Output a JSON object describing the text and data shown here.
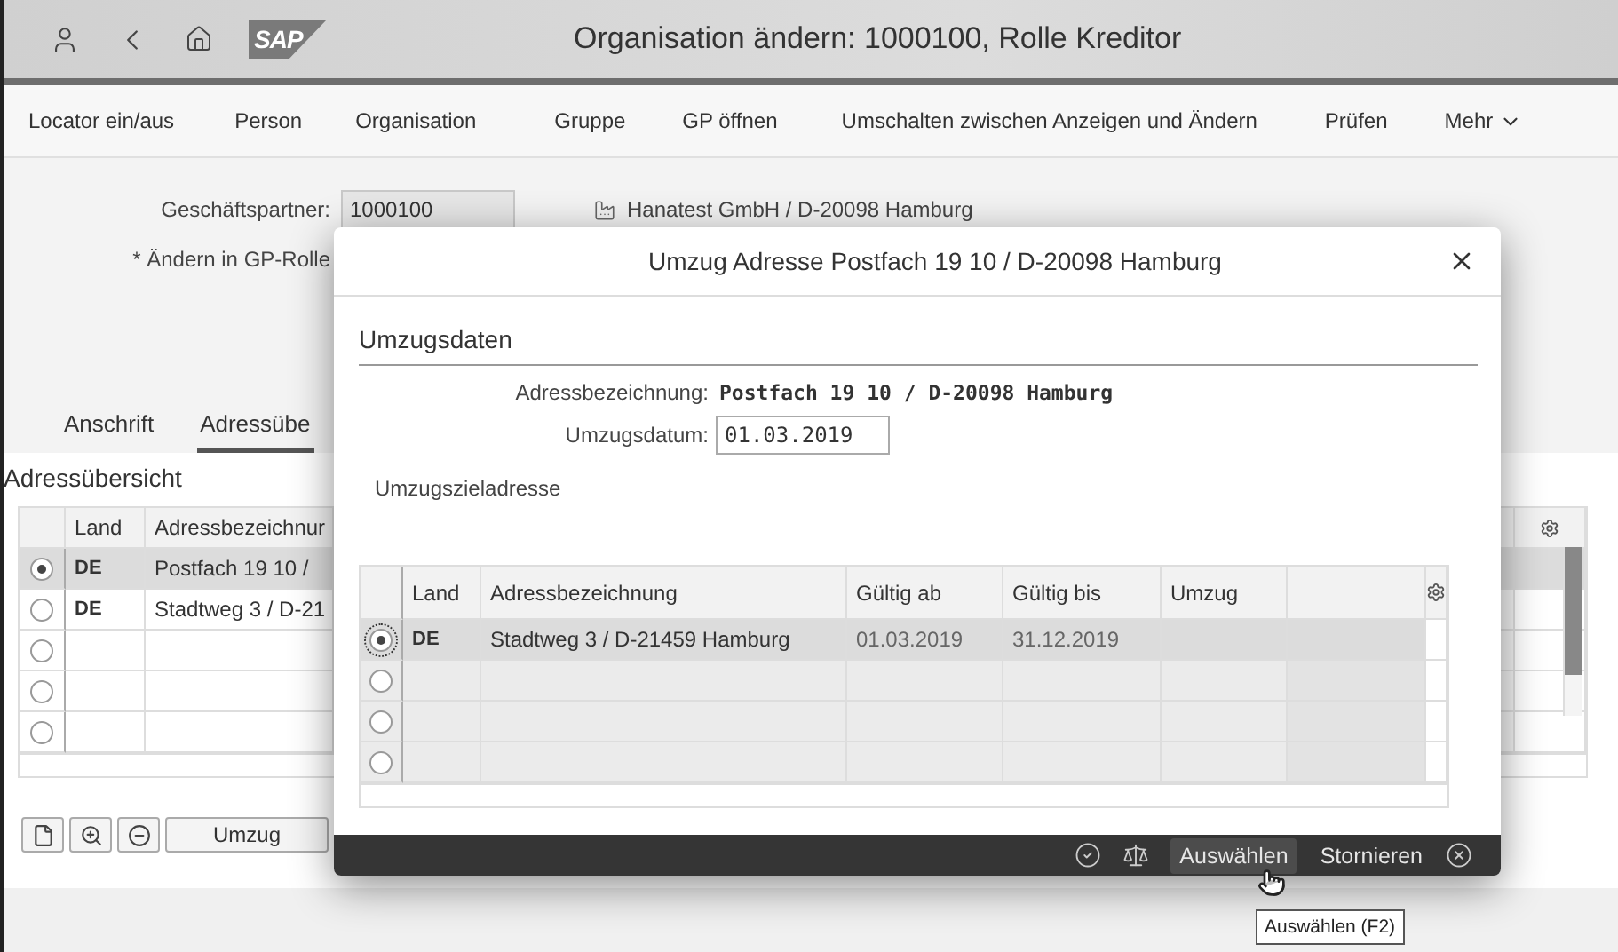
{
  "shell": {
    "logo": "SAP",
    "title": "Organisation ändern: 1000100, Rolle Kreditor"
  },
  "toolbar": [
    {
      "label": "Locator ein/aus",
      "kind": "action"
    },
    {
      "label": "Person",
      "kind": "action"
    },
    {
      "label": "Organisation",
      "kind": "action"
    },
    {
      "label": "Gruppe",
      "kind": "action"
    },
    {
      "label": "GP öffnen",
      "kind": "action"
    },
    {
      "label": "Umschalten zwischen Anzeigen und Ändern",
      "kind": "action"
    },
    {
      "label": "Prüfen",
      "kind": "action"
    },
    {
      "label": "Mehr",
      "kind": "menu"
    }
  ],
  "form": {
    "partner_label": "Geschäftspartner:",
    "partner_value": "1000100",
    "partner_name": "Hanatest GmbH / D-20098 Hamburg",
    "role_label": "* Ändern in GP-Rolle"
  },
  "tabs": [
    {
      "label": "Anschrift",
      "selected": false
    },
    {
      "label": "Adressübe",
      "selected": true
    }
  ],
  "address_overview": {
    "title": "Adressübersicht",
    "columns": [
      "Land",
      "Adressbezeichnur"
    ],
    "rows": [
      {
        "selected": true,
        "land": "DE",
        "address": "Postfach 19 10 /"
      },
      {
        "selected": false,
        "land": "DE",
        "address": "Stadtweg 3 / D-21"
      },
      {
        "selected": false
      },
      {
        "selected": false
      },
      {
        "selected": false
      }
    ]
  },
  "actions": [
    {
      "label": "Umzug"
    }
  ],
  "dialog": {
    "title": "Umzug Adresse Postfach 19 10 / D-20098 Hamburg",
    "section": "Umzugsdaten",
    "fields": [
      {
        "label": "Adressbezeichnung:",
        "value": "Postfach 19 10 / D-20098 Hamburg",
        "kind": "display"
      },
      {
        "label": "Umzugsdatum:",
        "value": "01.03.2019",
        "kind": "input"
      }
    ],
    "target_label": "Umzugszieladresse",
    "table": {
      "columns": [
        "Land",
        "Adressbezeichnung",
        "Gültig ab",
        "Gültig bis",
        "Umzug"
      ],
      "rows": [
        {
          "selected": true,
          "land": "DE",
          "address": "Stadtweg 3 / D-21459 Hamburg",
          "valid_from": "01.03.2019",
          "valid_to": "31.12.2019"
        },
        {
          "selected": false
        },
        {
          "selected": false
        },
        {
          "selected": false
        }
      ]
    },
    "buttons": [
      {
        "label": "Auswählen",
        "hovered": true
      },
      {
        "label": "Stornieren",
        "hovered": false
      }
    ]
  },
  "tooltip": "Auswählen (F2)"
}
